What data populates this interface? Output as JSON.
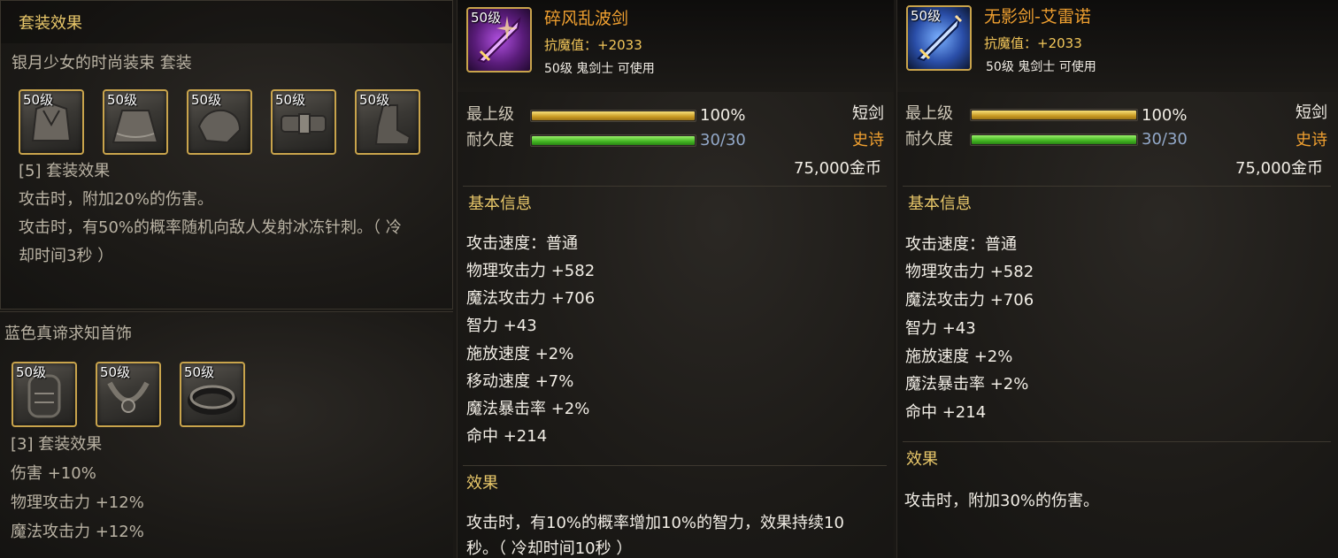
{
  "set_panel": {
    "header": "套装效果",
    "set_name": "银月少女的时尚装束 套装",
    "items": [
      {
        "level": "50级",
        "icon": "cloth-icon"
      },
      {
        "level": "50级",
        "icon": "skirt-icon"
      },
      {
        "level": "50级",
        "icon": "shoulder-icon"
      },
      {
        "level": "50级",
        "icon": "belt-icon"
      },
      {
        "level": "50级",
        "icon": "boots-icon"
      }
    ],
    "bonus_title": "[5] 套装效果",
    "bonus_lines": [
      "攻击时，附加20%的伤害。",
      "攻击时，有50%的概率随机向敌人发射冰冻针刺。（ 冷",
      "却时间3秒 ）"
    ]
  },
  "set_panel2": {
    "set_name": "蓝色真谛求知首饰",
    "items": [
      {
        "level": "50级",
        "icon": "bracelet-icon"
      },
      {
        "level": "50级",
        "icon": "necklace-icon"
      },
      {
        "level": "50级",
        "icon": "ring-icon"
      }
    ],
    "bonus_title": "[3] 套装效果",
    "bonus_lines": [
      "伤害 +10%",
      "物理攻击力 +12%",
      "魔法攻击力 +12%"
    ]
  },
  "weapon1": {
    "level": "50级",
    "name": "碎风乱波剑",
    "anti_magic": "抗魔值：+2033",
    "requirement": "50级 鬼剑士 可使用",
    "grade_label": "最上级",
    "grade_value": "100%",
    "grade_fraction": 1.0,
    "durability_label": "耐久度",
    "durability_value": "30/30",
    "durability_fraction": 1.0,
    "type": "短剑",
    "rarity": "史诗",
    "price": "75,000金币",
    "basic_header": "基本信息",
    "stats": [
      "攻击速度：普通",
      "物理攻击力 +582",
      "魔法攻击力 +706",
      "智力 +43",
      "施放速度 +2%",
      "移动速度 +7%",
      "魔法暴击率 +2%",
      "命中 +214"
    ],
    "effect_header": "效果",
    "effect_lines": [
      "攻击时，有10%的概率增加10%的智力，效果持续10",
      "秒。（ 冷却时间10秒 ）"
    ],
    "colors": {
      "accent": "#c040e0"
    }
  },
  "weapon2": {
    "level": "50级",
    "name": "无影剑-艾雷诺",
    "anti_magic": "抗魔值：+2033",
    "requirement": "50级 鬼剑士 可使用",
    "grade_label": "最上级",
    "grade_value": "100%",
    "grade_fraction": 1.0,
    "durability_label": "耐久度",
    "durability_value": "30/30",
    "durability_fraction": 1.0,
    "type": "短剑",
    "rarity": "史诗",
    "price": "75,000金币",
    "basic_header": "基本信息",
    "stats": [
      "攻击速度：普通",
      "物理攻击力 +582",
      "魔法攻击力 +706",
      "智力 +43",
      "施放速度 +2%",
      "魔法暴击率 +2%",
      "命中 +214"
    ],
    "effect_header": "效果",
    "effect_lines": [
      "攻击时，附加30%的伤害。"
    ],
    "colors": {
      "accent": "#4090f0"
    }
  }
}
